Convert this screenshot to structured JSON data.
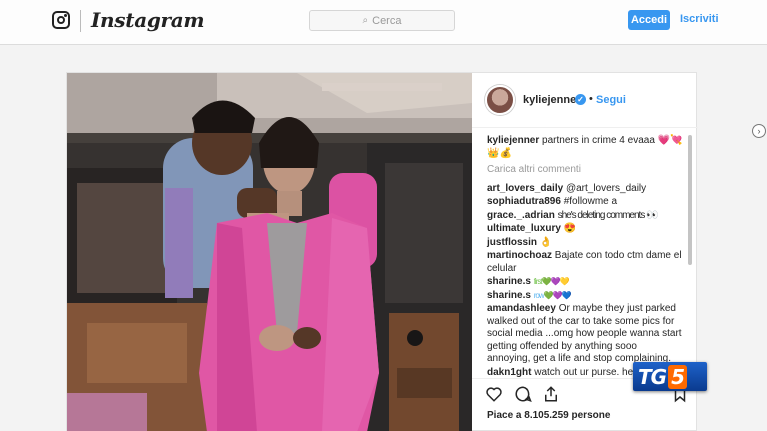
{
  "nav": {
    "brand": "Instagram",
    "search_placeholder": "Cerca",
    "login_label": "Accedi",
    "signup_label": "Iscriviti"
  },
  "post": {
    "username": "kyliejenner",
    "verified": true,
    "separator": "•",
    "follow_label": "Segui",
    "caption_user": "kyliejenner",
    "caption_text": "partners in crime 4 evaaa",
    "caption_emoji": "💗💘👑💰",
    "load_more": "Carica altri commenti",
    "likes": "Piace a 8.105.259 persone",
    "comments": [
      {
        "user": "art_lovers_daily",
        "text": "@art_lovers_daily"
      },
      {
        "user": "sophiadutra896",
        "text": "#followme a"
      },
      {
        "user": "grace._.adrian",
        "text": "she's deleting comments 👀"
      },
      {
        "user": "ultimate_luxury",
        "text": "😍"
      },
      {
        "user": "justflossin",
        "text": "👌"
      },
      {
        "user": "martinochoaz",
        "text": "Bajate con todo ctm dame el celular"
      },
      {
        "user": "sharine.s",
        "text": "first💚💜💛"
      },
      {
        "user": "sharine.s",
        "text": "row💚💜💙"
      },
      {
        "user": "amandashleey",
        "text": "Or maybe they just parked walked out of the car to take some pics for social media ...omg how people wanna start getting offended by anything sooo annoying, get a life and stop complaining."
      },
      {
        "user": "dakn1ght",
        "text": "watch out ur purse. he'll steal that"
      }
    ]
  },
  "broadcast": {
    "logo_tg": "TG",
    "logo_five": "5"
  },
  "colors": {
    "accent": "#3897f0",
    "jacket_pink": "#ee5db0",
    "tg5_blue": "#0a3a8e",
    "tg5_orange": "#ff6a00"
  },
  "icons": [
    "instagram-logo-icon",
    "search-icon",
    "verified-badge-icon",
    "heart-icon",
    "comment-icon",
    "share-icon",
    "bookmark-icon",
    "chevron-right-icon"
  ]
}
